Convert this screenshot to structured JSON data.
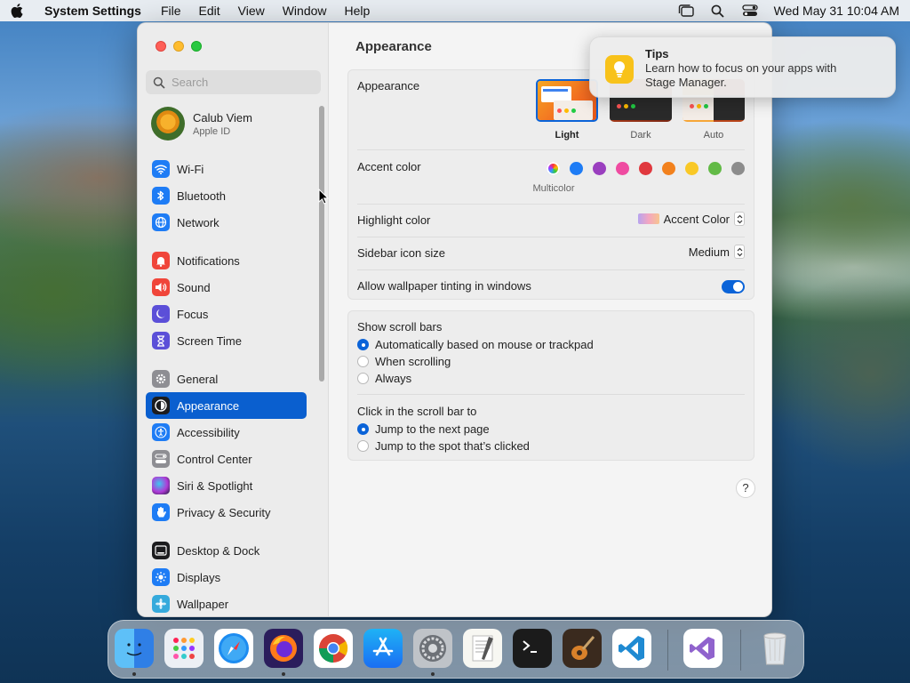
{
  "menubar": {
    "app_name": "System Settings",
    "menus": [
      "File",
      "Edit",
      "View",
      "Window",
      "Help"
    ],
    "datetime": "Wed May 31  10:04 AM"
  },
  "sidebar": {
    "search_placeholder": "Search",
    "profile": {
      "name": "Calub Viem",
      "subtitle": "Apple ID"
    },
    "items": [
      {
        "label": "Wi-Fi",
        "icon": "wifi-icon",
        "color": "#1e7cf5"
      },
      {
        "label": "Bluetooth",
        "icon": "bluetooth-icon",
        "color": "#1e7cf5"
      },
      {
        "label": "Network",
        "icon": "globe-icon",
        "color": "#1e7cf5"
      },
      {
        "label": "Notifications",
        "icon": "bell-icon",
        "color": "#f0453a"
      },
      {
        "label": "Sound",
        "icon": "speaker-icon",
        "color": "#f0453a"
      },
      {
        "label": "Focus",
        "icon": "moon-icon",
        "color": "#5b4fd8"
      },
      {
        "label": "Screen Time",
        "icon": "hourglass-icon",
        "color": "#5b4fd8"
      },
      {
        "label": "General",
        "icon": "gear-icon",
        "color": "#8e8e93"
      },
      {
        "label": "Appearance",
        "icon": "appearance-icon",
        "color": "#1c1c1e"
      },
      {
        "label": "Accessibility",
        "icon": "accessibility-icon",
        "color": "#1e7cf5"
      },
      {
        "label": "Control Center",
        "icon": "control-center-icon",
        "color": "#8e8e93"
      },
      {
        "label": "Siri & Spotlight",
        "icon": "siri-icon",
        "color": "#b03ad6"
      },
      {
        "label": "Privacy & Security",
        "icon": "hand-icon",
        "color": "#1e7cf5"
      },
      {
        "label": "Desktop & Dock",
        "icon": "dock-icon",
        "color": "#1c1c1e"
      },
      {
        "label": "Displays",
        "icon": "sun-icon",
        "color": "#1e7cf5"
      },
      {
        "label": "Wallpaper",
        "icon": "wallpaper-icon",
        "color": "#35aadc"
      }
    ]
  },
  "main": {
    "title": "Appearance",
    "appearance": {
      "label": "Appearance",
      "options": [
        "Light",
        "Dark",
        "Auto"
      ],
      "selected": "Light"
    },
    "accent": {
      "label": "Accent color",
      "colors": [
        "multicolor",
        "#1e7cf5",
        "#9a3fbf",
        "#ef4ba1",
        "#e0383e",
        "#f2811d",
        "#f9c826",
        "#62ba46",
        "#8c8c8c"
      ],
      "selected_name": "Multicolor"
    },
    "highlight": {
      "label": "Highlight color",
      "value": "Accent Color"
    },
    "icon_size": {
      "label": "Sidebar icon size",
      "value": "Medium"
    },
    "tinting": {
      "label": "Allow wallpaper tinting in windows",
      "enabled": true
    },
    "scroll_bars": {
      "label": "Show scroll bars",
      "options": [
        "Automatically based on mouse or trackpad",
        "When scrolling",
        "Always"
      ],
      "selected": 0
    },
    "click_scroll": {
      "label": "Click in the scroll bar to",
      "options": [
        "Jump to the next page",
        "Jump to the spot that’s clicked"
      ],
      "selected": 0
    },
    "help": "?"
  },
  "notification": {
    "title": "Tips",
    "body": "Learn how to focus on your apps with Stage Manager."
  },
  "dock": {
    "apps": [
      "Finder",
      "Launchpad",
      "Safari",
      "Firefox",
      "Chrome",
      "App Store",
      "System Settings",
      "TextEdit",
      "Terminal",
      "GarageBand",
      "Visual Studio Code",
      "Visual Studio",
      "Trash"
    ]
  }
}
